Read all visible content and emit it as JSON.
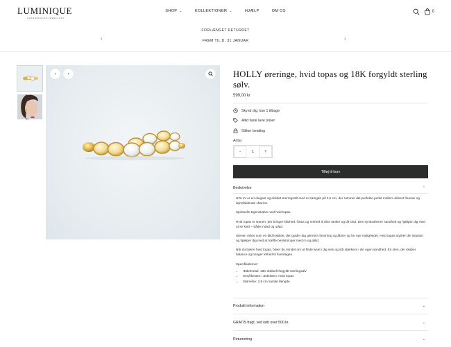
{
  "header": {
    "logo": "LUMINIQUE",
    "logo_sub": "SCANDINAVIAN JEWELLERY",
    "nav": [
      {
        "label": "SHOP",
        "has_chevron": true
      },
      {
        "label": "KOLLEKTIONER",
        "has_chevron": true
      },
      {
        "label": "HJÆLP",
        "has_chevron": false
      },
      {
        "label": "OM OS",
        "has_chevron": false
      }
    ],
    "cart_count": "0"
  },
  "announcement": {
    "line1": "FORLÆNGET RETURRET",
    "line2": "FREM TIL D. 31 JANUAR",
    "prev": "‹",
    "next": "›"
  },
  "product": {
    "title": "HOLLY øreringe, hvid topas og 18K forgyldt sterling sølv.",
    "price": "599,00 kr",
    "features": [
      {
        "icon": "clock-icon",
        "label": "Skynd dig, kun 1 tilbage"
      },
      {
        "icon": "tag-icon",
        "label": "Altid faste lave priser"
      },
      {
        "icon": "lock-icon",
        "label": "Sikker betaling"
      }
    ],
    "qty_label": "Antal",
    "qty_minus": "-",
    "qty_value": "1",
    "qty_plus": "+",
    "add_to_cart": "Tilføj til kurv"
  },
  "accordion": {
    "description_title": "Beskrivelse",
    "description": {
      "p1": "HOLLY er en elegant og delikat øreringsstil med en længde på 2,5 cm, der rammer det perfekte punkt mellem diskret finesse og iøjnefaldende charme.",
      "p2": "Spirituelle Egenskaber ved hvid topas",
      "p3": "Hvid topas er stenen, der bringer klarhed, fokus og renhed til dine tanker og dit sind. Den symboliserer sandhed og hjælper dig med at se klart – både indad og udad.",
      "p4": "Stenen virker som en blid lyskilde, der guider dig gennem forvirring og åbner op for nye muligheder. Hvid topas styrker din intuition og hjælper dig med at træffe beslutninger med ro og plilid.",
      "p5": "Når du bærer hvid topas, bliver du mindet om at finde lyset i dig selv og stå stærkere i din egen sandhed. En sten, der skaber balance og bringer lethed til hverdagen.",
      "spec_title": "Specifikationer:",
      "specs": [
        "Ædelmetal: 18K dobbelt forgyldt sterlingsølv",
        "Smykkesten / ædelsten: Hvid topas",
        "Størrelse: 2,5 cm samlet længde"
      ]
    },
    "sections": [
      {
        "label": "Produkt information"
      },
      {
        "label": "GRATIS fragt, ved køb over 500 kr."
      },
      {
        "label": "Returnering"
      }
    ]
  },
  "colors": {
    "button_dark": "#2b2d2d",
    "gold": "#d9b24a",
    "topaz": "#f4f6f4"
  }
}
